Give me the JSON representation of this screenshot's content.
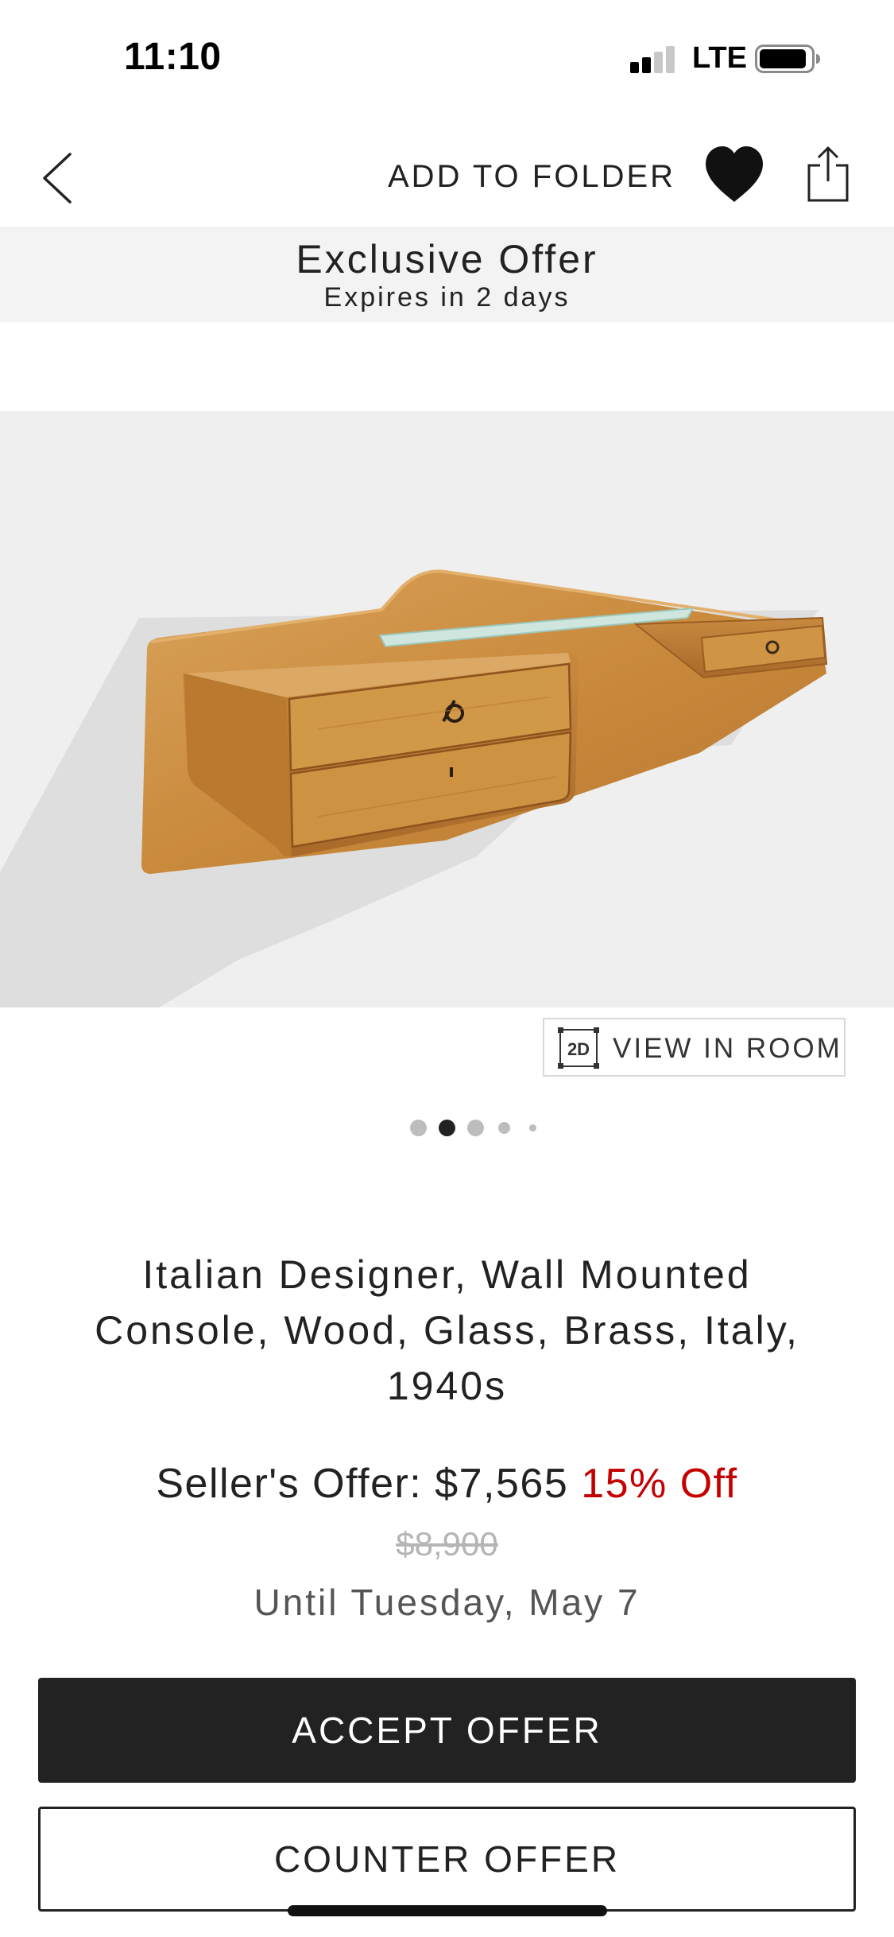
{
  "status_bar": {
    "time": "11:10",
    "network": "LTE",
    "signal_bars": 2,
    "signal_bars_total": 4,
    "battery_level": 0.8
  },
  "nav": {
    "back_icon": "chevron-left-icon",
    "add_to_folder_label": "ADD TO FOLDER",
    "favorite_icon": "heart-icon",
    "share_icon": "share-icon"
  },
  "offer_banner": {
    "title": "Exclusive Offer",
    "expires": "Expires in 2 days"
  },
  "product_image": {
    "background_color": "#efefef"
  },
  "view_in_room": {
    "icon_text": "2D",
    "label": "VIEW IN ROOM"
  },
  "carousel": {
    "count": 5,
    "active_index": 1
  },
  "product": {
    "title": "Italian Designer, Wall Mounted Console, Wood, Glass, Brass, Italy, 1940s"
  },
  "pricing": {
    "offer_prefix": "Seller's Offer: $7,565",
    "discount": "15% Off",
    "original_price": "$8,900",
    "until": "Until Tuesday, May 7",
    "discount_color": "#c40000"
  },
  "actions": {
    "accept_label": "ACCEPT OFFER",
    "counter_label": "COUNTER OFFER"
  }
}
